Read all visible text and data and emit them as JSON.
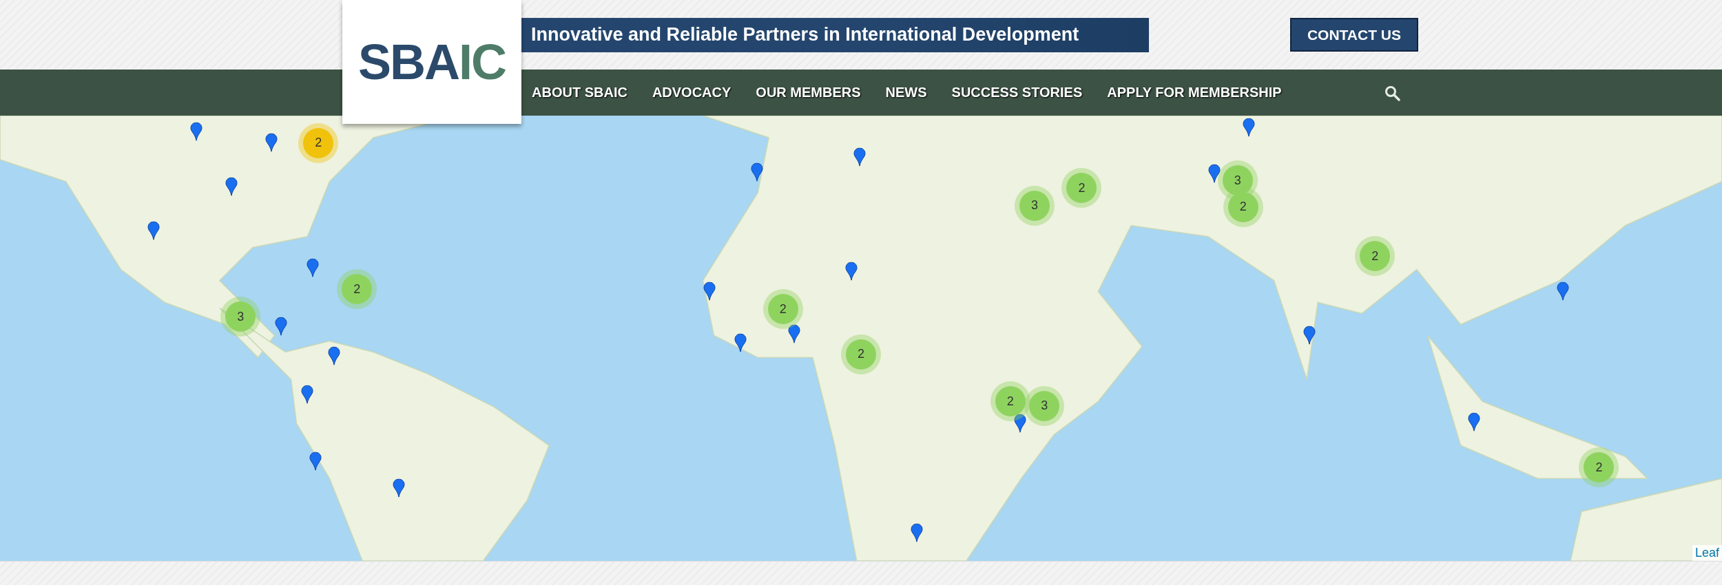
{
  "logo": {
    "parts": [
      "SBA",
      "IC"
    ]
  },
  "tagline": "Innovative and Reliable Partners in International Development",
  "contact_button": "CONTACT US",
  "nav": [
    "ABOUT SBAIC",
    "ADVOCACY",
    "OUR MEMBERS",
    "NEWS",
    "SUCCESS STORIES",
    "APPLY FOR MEMBERSHIP"
  ],
  "map": {
    "markers": [
      {
        "kind": "cluster",
        "count": "2",
        "color": "#f0c20c"
      },
      {
        "kind": "pin"
      },
      {
        "kind": "pin"
      },
      {
        "kind": "pin"
      },
      {
        "kind": "pin"
      },
      {
        "kind": "pin"
      },
      {
        "kind": "pin"
      },
      {
        "kind": "pin"
      },
      {
        "kind": "pin"
      },
      {
        "kind": "pin"
      },
      {
        "kind": "pin"
      },
      {
        "kind": "pin"
      },
      {
        "kind": "pin"
      },
      {
        "kind": "pin"
      },
      {
        "kind": "pin"
      },
      {
        "kind": "pin"
      },
      {
        "kind": "pin"
      },
      {
        "kind": "pin"
      },
      {
        "kind": "pin"
      },
      {
        "kind": "pin"
      },
      {
        "kind": "pin"
      },
      {
        "kind": "pin"
      },
      {
        "kind": "pin"
      },
      {
        "kind": "pin"
      },
      {
        "kind": "cluster",
        "count": "2",
        "color": "#8fd35f"
      },
      {
        "kind": "cluster",
        "count": "3",
        "color": "#8fd35f"
      },
      {
        "kind": "cluster",
        "count": "2",
        "color": "#8fd35f"
      },
      {
        "kind": "cluster",
        "count": "2",
        "color": "#8fd35f"
      },
      {
        "kind": "cluster",
        "count": "2",
        "color": "#8fd35f"
      },
      {
        "kind": "cluster",
        "count": "3",
        "color": "#8fd35f"
      },
      {
        "kind": "cluster",
        "count": "3",
        "color": "#8fd35f"
      },
      {
        "kind": "cluster",
        "count": "2",
        "color": "#8fd35f"
      },
      {
        "kind": "cluster",
        "count": "2",
        "color": "#8fd35f"
      },
      {
        "kind": "cluster",
        "count": "2",
        "color": "#8fd35f"
      },
      {
        "kind": "cluster",
        "count": "3",
        "color": "#8fd35f"
      },
      {
        "kind": "cluster",
        "count": "2",
        "color": "#8fd35f"
      }
    ],
    "attribution": "Leaf"
  }
}
